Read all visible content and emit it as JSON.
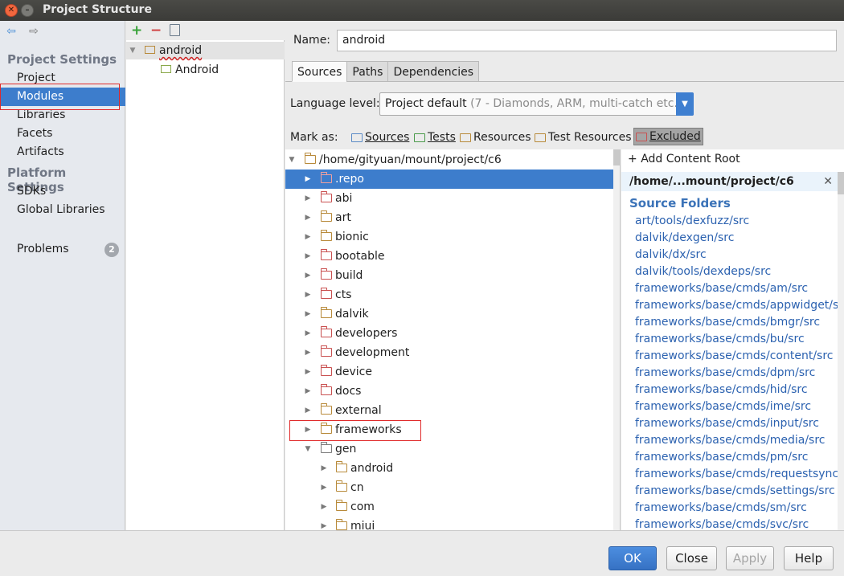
{
  "window": {
    "title": "Project Structure"
  },
  "nav": {
    "project_settings_heading": "Project Settings",
    "project_settings_items": [
      "Project",
      "Modules",
      "Libraries",
      "Facets",
      "Artifacts"
    ],
    "selected": "Modules",
    "platform_settings_heading": "Platform Settings",
    "platform_settings_items": [
      "SDKs",
      "Global Libraries"
    ],
    "problems_label": "Problems",
    "problems_count": "2"
  },
  "modules": {
    "root": "android",
    "child": "Android"
  },
  "module_editor": {
    "name_label": "Name:",
    "name_value": "android",
    "tabs": [
      "Sources",
      "Paths",
      "Dependencies"
    ],
    "active_tab": "Sources",
    "language_level_label": "Language level:",
    "language_level_value": "Project default",
    "language_level_hint": "(7 - Diamonds, ARM, multi-catch etc.)",
    "mark_as_label": "Mark as:",
    "mark_as": [
      "Sources",
      "Tests",
      "Resources",
      "Test Resources",
      "Excluded"
    ]
  },
  "tree": {
    "root_path": "/home/gityuan/mount/project/c6",
    "items": [
      {
        "name": ".repo",
        "kind": "excluded",
        "selected": true
      },
      {
        "name": "abi",
        "kind": "excluded"
      },
      {
        "name": "art",
        "kind": "normal"
      },
      {
        "name": "bionic",
        "kind": "normal"
      },
      {
        "name": "bootable",
        "kind": "excluded"
      },
      {
        "name": "build",
        "kind": "excluded"
      },
      {
        "name": "cts",
        "kind": "excluded"
      },
      {
        "name": "dalvik",
        "kind": "normal"
      },
      {
        "name": "developers",
        "kind": "excluded"
      },
      {
        "name": "development",
        "kind": "excluded"
      },
      {
        "name": "device",
        "kind": "excluded"
      },
      {
        "name": "docs",
        "kind": "excluded"
      },
      {
        "name": "external",
        "kind": "normal"
      },
      {
        "name": "frameworks",
        "kind": "normal"
      },
      {
        "name": "gen",
        "kind": "source"
      }
    ],
    "gen_children": [
      "android",
      "cn",
      "com",
      "miui"
    ]
  },
  "content_root": {
    "add_label": "Add Content Root",
    "root_label": "/home/...mount/project/c6",
    "source_folders_heading": "Source Folders",
    "source_folders": [
      "art/tools/dexfuzz/src",
      "dalvik/dexgen/src",
      "dalvik/dx/src",
      "dalvik/tools/dexdeps/src",
      "frameworks/base/cmds/am/src",
      "frameworks/base/cmds/appwidget/s",
      "frameworks/base/cmds/bmgr/src",
      "frameworks/base/cmds/bu/src",
      "frameworks/base/cmds/content/src",
      "frameworks/base/cmds/dpm/src",
      "frameworks/base/cmds/hid/src",
      "frameworks/base/cmds/ime/src",
      "frameworks/base/cmds/input/src",
      "frameworks/base/cmds/media/src",
      "frameworks/base/cmds/pm/src",
      "frameworks/base/cmds/requestsync",
      "frameworks/base/cmds/settings/src",
      "frameworks/base/cmds/sm/src",
      "frameworks/base/cmds/svc/src"
    ]
  },
  "buttons": {
    "ok": "OK",
    "close": "Close",
    "apply": "Apply",
    "help": "Help"
  },
  "colors": {
    "selection": "#3d7dcc",
    "highlight_box": "#e02a2a",
    "link": "#2c62b0",
    "excluded_folder": "#c95050"
  }
}
